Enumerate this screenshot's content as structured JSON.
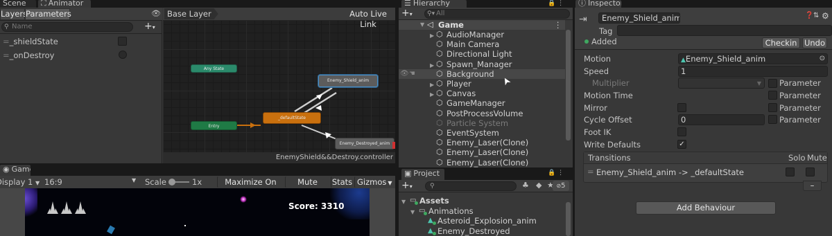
{
  "tabs": {
    "scene": "Scene",
    "animator": "Animator",
    "hierarchy": "Hierarchy",
    "inspector": "Inspector",
    "game": "Game",
    "project": "Project"
  },
  "animator": {
    "layers_tab": "Layers",
    "parameters_tab": "Parameters",
    "search_placeholder": "Name",
    "parameters": [
      {
        "name": "_shieldState",
        "kind": "bool"
      },
      {
        "name": "_onDestroy",
        "kind": "trigger"
      }
    ],
    "breadcrumb": "Base Layer",
    "auto_live_link": "Auto Live Link",
    "footer": "EnemyShield&&Destroy.controller",
    "nodes": {
      "any_state": "Any State",
      "entry": "Entry",
      "default_state": "_defaultState",
      "shield_anim": "Enemy_Shield_anim",
      "destroyed_anim": "Enemy_Destroyed_anim"
    }
  },
  "game": {
    "display": "Display 1",
    "aspect": "16:9",
    "scale_label": "Scale",
    "scale_value": "1x",
    "maximize": "Maximize On Play",
    "mute": "Mute Audio",
    "stats": "Stats",
    "gizmos": "Gizmos",
    "score": "Score: 3310"
  },
  "hierarchy": {
    "search_placeholder": "All",
    "root": "Game",
    "items": [
      {
        "label": "AudioManager",
        "expandable": true,
        "dim": false
      },
      {
        "label": "Main Camera",
        "expandable": false,
        "dim": false
      },
      {
        "label": "Directional Light",
        "expandable": false,
        "dim": false
      },
      {
        "label": "Spawn_Manager",
        "expandable": true,
        "dim": false
      },
      {
        "label": "Background",
        "expandable": false,
        "dim": false,
        "hovered": true
      },
      {
        "label": "Player",
        "expandable": true,
        "dim": false
      },
      {
        "label": "Canvas",
        "expandable": true,
        "dim": false
      },
      {
        "label": "GameManager",
        "expandable": false,
        "dim": false
      },
      {
        "label": "PostProcessVolume",
        "expandable": false,
        "dim": false
      },
      {
        "label": "Particle System",
        "expandable": false,
        "dim": true
      },
      {
        "label": "EventSystem",
        "expandable": false,
        "dim": false
      },
      {
        "label": "Enemy_Laser(Clone)",
        "expandable": false,
        "dim": false
      },
      {
        "label": "Enemy_Laser(Clone)",
        "expandable": false,
        "dim": false
      },
      {
        "label": "Enemy_Laser(Clone)",
        "expandable": false,
        "dim": false
      }
    ]
  },
  "project": {
    "badge": "5",
    "tree": [
      {
        "label": "Assets",
        "level": 0
      },
      {
        "label": "Animations",
        "level": 1
      },
      {
        "label": "Asteroid_Explosion_anim",
        "level": 2
      },
      {
        "label": "Enemy_Destroyed",
        "level": 2
      }
    ]
  },
  "inspector": {
    "name": "Enemy_Shield_anim",
    "tag_label": "Tag",
    "added": "Added",
    "checkin": "Checkin",
    "undo": "Undo",
    "fields": {
      "motion_label": "Motion",
      "motion_value": "Enemy_Shield_anim",
      "speed_label": "Speed",
      "speed_value": "1",
      "multiplier_label": "Multiplier",
      "motion_time_label": "Motion Time",
      "mirror_label": "Mirror",
      "cycle_offset_label": "Cycle Offset",
      "cycle_offset_value": "0",
      "foot_ik_label": "Foot IK",
      "write_defaults_label": "Write Defaults",
      "parameter": "Parameter"
    },
    "transitions": {
      "header": "Transitions",
      "solo": "Solo",
      "mute": "Mute",
      "row": "Enemy_Shield_anim -> _defaultState",
      "minus": "–"
    },
    "add_behaviour": "Add Behaviour"
  },
  "colors": {
    "entry": "#1f7a45",
    "any_state": "#2b8a6b",
    "default_state": "#c9700e",
    "state_grey": "#5c5c5c",
    "selected_outline": "#4a90c8",
    "accent_green": "#3fa860"
  }
}
